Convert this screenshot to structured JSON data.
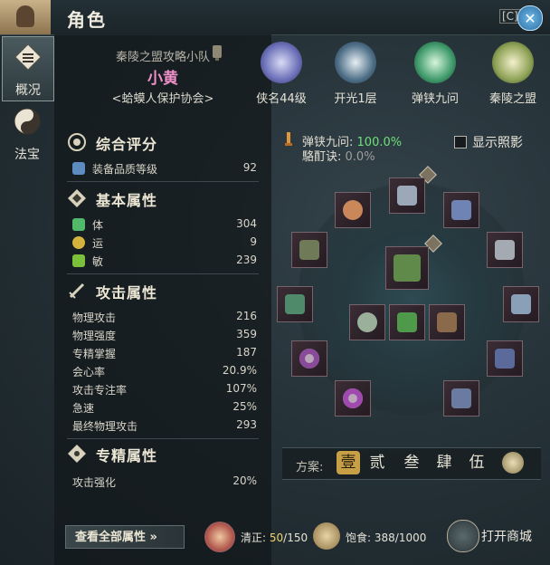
{
  "window": {
    "title": "角色",
    "hotkey": "[C]"
  },
  "tabs": [
    {
      "label": "概况"
    },
    {
      "label": "法宝"
    }
  ],
  "profile": {
    "team": "秦陵之盟攻略小队",
    "name": "小黄",
    "guild": "<蛤蟆人保护协会>"
  },
  "badges": [
    {
      "label": "侠名44级",
      "color": "#6b6fb8"
    },
    {
      "label": "开光1层",
      "color": "#4e6f88"
    },
    {
      "label": "弹铗九问",
      "color": "#3f9a6a"
    },
    {
      "label": "秦陵之盟",
      "color": "#8ea256"
    }
  ],
  "sections": {
    "overall": {
      "title": "综合评分",
      "rows": [
        {
          "label": "装备品质等级",
          "value": "92"
        }
      ]
    },
    "basic": {
      "title": "基本属性",
      "rows": [
        {
          "label": "体",
          "value": "304"
        },
        {
          "label": "运",
          "value": "9"
        },
        {
          "label": "敏",
          "value": "239"
        }
      ]
    },
    "attack": {
      "title": "攻击属性",
      "rows": [
        {
          "label": "物理攻击",
          "value": "216"
        },
        {
          "label": "物理强度",
          "value": "359"
        },
        {
          "label": "专精掌握",
          "value": "187"
        },
        {
          "label": "会心率",
          "value": "20.9%"
        },
        {
          "label": "攻击专注率",
          "value": "107%"
        },
        {
          "label": "急速",
          "value": "25%"
        },
        {
          "label": "最终物理攻击",
          "value": "293"
        }
      ]
    },
    "mastery": {
      "title": "专精属性",
      "rows": [
        {
          "label": "攻击强化",
          "value": "20%"
        }
      ]
    }
  },
  "view_all": "查看全部属性",
  "bounce": {
    "label": "弹铗九问:",
    "value": "100.0%"
  },
  "anti": {
    "label": "駱酊诀:",
    "value": "0.0%"
  },
  "show_glow": {
    "label": "显示照影"
  },
  "plan": {
    "label": "方案:",
    "options": [
      "壹",
      "贰",
      "叁",
      "肆",
      "伍"
    ],
    "selected": "壹"
  },
  "footer": {
    "cleanse_label": "清正:",
    "cleanse_current": "50",
    "cleanse_max": "/150",
    "food_label": "饱食:",
    "food_value": "388/1000",
    "shop_label": "打开商城"
  },
  "colors": {
    "green_value": "#6fe07a",
    "name_pink": "#ee8fc8",
    "accent_gold": "#c7a046"
  }
}
